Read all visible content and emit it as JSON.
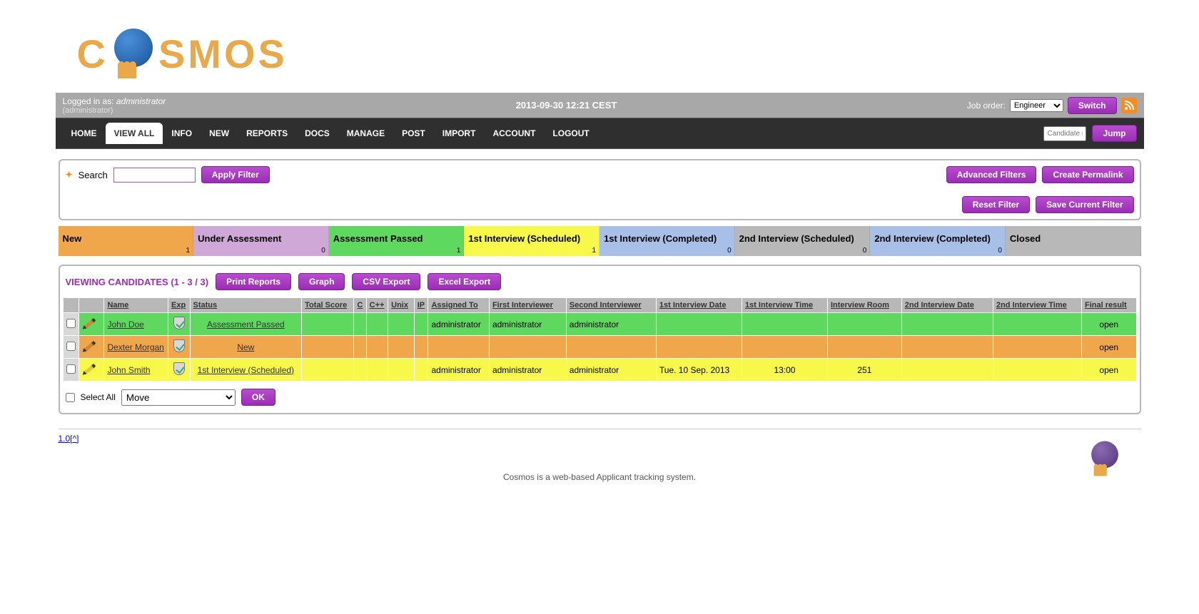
{
  "logo_text_left": "C",
  "logo_text_right": "SMOS",
  "status_bar": {
    "logged_in_label": "Logged in as: ",
    "username": "administrator",
    "role": "(administrator)",
    "datetime": "2013-09-30 12:21 CEST",
    "job_order_label": "Job order:",
    "job_order_value": "Engineer",
    "switch_btn": "Switch"
  },
  "nav": {
    "items": [
      "HOME",
      "VIEW ALL",
      "INFO",
      "NEW",
      "REPORTS",
      "DOCS",
      "MANAGE",
      "POST",
      "IMPORT",
      "ACCOUNT",
      "LOGOUT"
    ],
    "active_index": 1,
    "candidate_placeholder": "Candidate #",
    "jump_btn": "Jump"
  },
  "filter": {
    "search_label": "Search",
    "apply_btn": "Apply Filter",
    "advanced_btn": "Advanced Filters",
    "permalink_btn": "Create Permalink",
    "reset_btn": "Reset Filter",
    "save_btn": "Save Current Filter"
  },
  "statuses": [
    {
      "label": "New",
      "count": "1",
      "class": "st-new"
    },
    {
      "label": "Under Assessment",
      "count": "0",
      "class": "st-under"
    },
    {
      "label": "Assessment Passed",
      "count": "1",
      "class": "st-passed"
    },
    {
      "label": "1st Interview (Scheduled)",
      "count": "1",
      "class": "st-1sched"
    },
    {
      "label": "1st Interview (Completed)",
      "count": "0",
      "class": "st-1comp"
    },
    {
      "label": "2nd Interview (Scheduled)",
      "count": "0",
      "class": "st-2sched"
    },
    {
      "label": "2nd Interview (Completed)",
      "count": "0",
      "class": "st-2comp"
    },
    {
      "label": "Closed",
      "count": "",
      "class": "st-closed"
    }
  ],
  "table": {
    "title": "VIEWING CANDIDATES (1 - 3 / 3)",
    "print_btn": "Print Reports",
    "graph_btn": "Graph",
    "csv_btn": "CSV Export",
    "excel_btn": "Excel Export",
    "headers": {
      "name": "Name",
      "exp": "Exp",
      "status": "Status",
      "tscore": "Total Score",
      "c": "C",
      "cpp": "C++",
      "unix": "Unix",
      "ip": "IP",
      "assigned": "Assigned To",
      "fi": "First Interviewer",
      "si": "Second Interviewer",
      "d1": "1st Interview Date",
      "t1": "1st Interview Time",
      "room": "Interview Room",
      "d2": "2nd Interview Date",
      "t2": "2nd Interview Time",
      "final": "Final result"
    },
    "rows": [
      {
        "row_class": "row-green",
        "name": "John Doe",
        "status": "Assessment Passed",
        "assigned": "administrator",
        "fi": "administrator",
        "si": "administrator",
        "d1": "",
        "t1": "",
        "room": "",
        "final": "open"
      },
      {
        "row_class": "row-orange",
        "name": "Dexter Morgan",
        "status": "New",
        "assigned": "",
        "fi": "",
        "si": "",
        "d1": "",
        "t1": "",
        "room": "",
        "final": "open"
      },
      {
        "row_class": "row-yellow",
        "name": "John Smith",
        "status": "1st Interview (Scheduled)",
        "assigned": "administrator",
        "fi": "administrator",
        "si": "administrator",
        "d1": "Tue. 10 Sep. 2013",
        "t1": "13:00",
        "room": "251",
        "final": "open"
      }
    ]
  },
  "below": {
    "select_all": "Select All",
    "move_option": "Move",
    "ok_btn": "OK"
  },
  "footer": {
    "version": "1.0[^]",
    "text": "Cosmos is a web-based Applicant tracking system."
  }
}
